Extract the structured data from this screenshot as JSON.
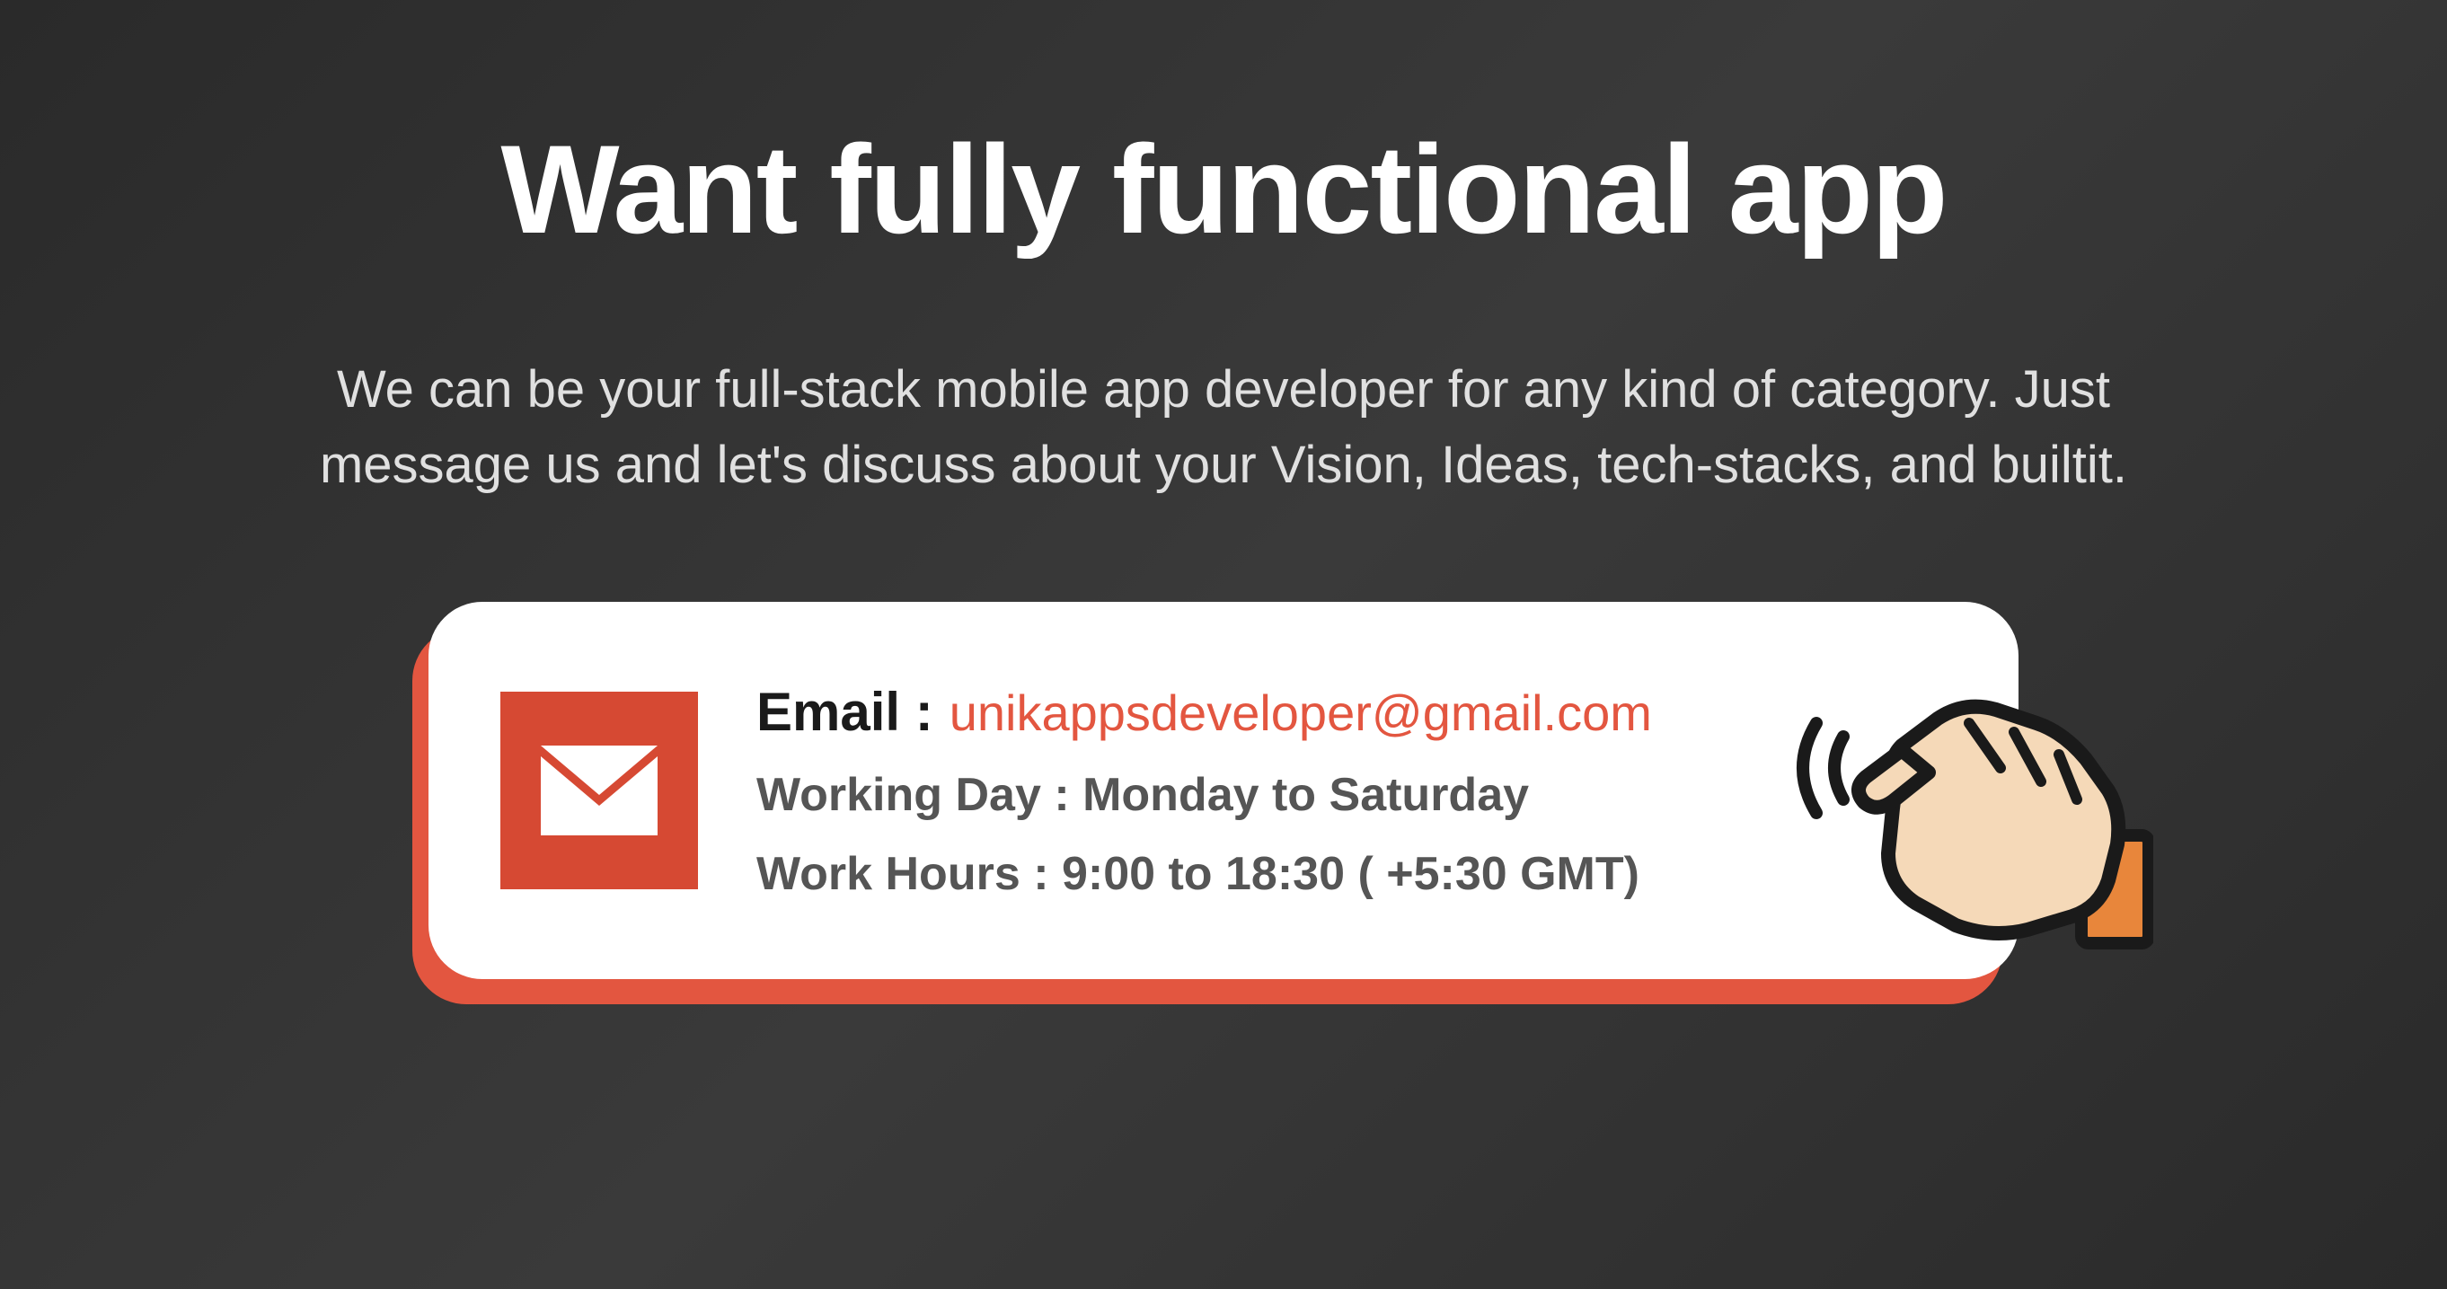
{
  "heading": "Want fully functional app",
  "description": "We can be your full-stack mobile app developer for any kind of category. Just message us and let's discuss about your Vision, Ideas, tech-stacks, and builtit.",
  "contact": {
    "email_label": "Email  :",
    "email_value": "unikappsdeveloper@gmail.com",
    "working_day": "Working Day : Monday to Saturday",
    "work_hours": "Work Hours : 9:00 to 18:30 ( +5:30 GMT)"
  }
}
